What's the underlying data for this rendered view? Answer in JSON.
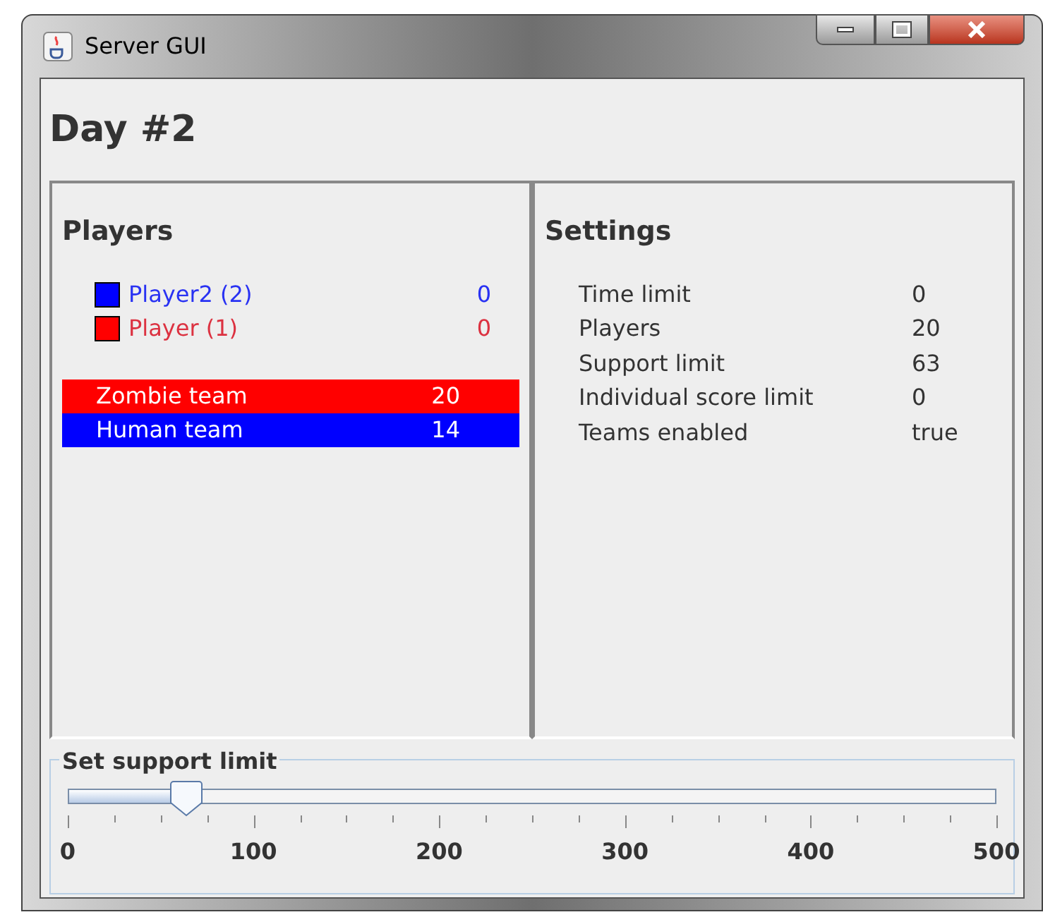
{
  "window": {
    "title": "Server GUI"
  },
  "heading": "Day #2",
  "players_panel": {
    "title": "Players",
    "players": [
      {
        "name": "Player2 (2)",
        "score": "0",
        "color": "#0000ff"
      },
      {
        "name": "Player (1)",
        "score": "0",
        "color": "#ff0000"
      }
    ],
    "teams": [
      {
        "name": "Zombie team",
        "score": "20",
        "color": "#ff0000"
      },
      {
        "name": "Human team",
        "score": "14",
        "color": "#0000ff"
      }
    ]
  },
  "settings_panel": {
    "title": "Settings",
    "settings": [
      {
        "label": "Time limit",
        "value": "0"
      },
      {
        "label": "Players",
        "value": "20"
      },
      {
        "label": "Support limit",
        "value": "63"
      },
      {
        "label": "Individual score limit",
        "value": "0"
      },
      {
        "label": "Teams enabled",
        "value": "true"
      }
    ]
  },
  "support_slider": {
    "title": "Set support limit",
    "level": 0.126,
    "labels": [
      "0",
      "100",
      "200",
      "300",
      "400",
      "500"
    ]
  }
}
